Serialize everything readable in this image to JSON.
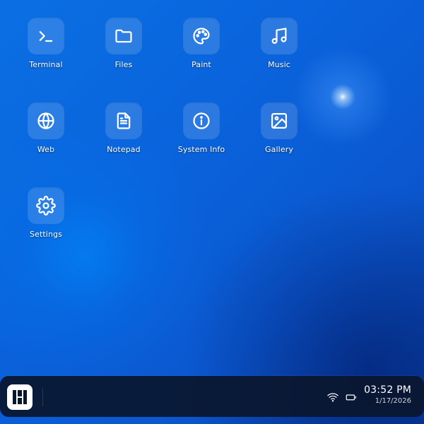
{
  "desktop": {
    "icons": [
      {
        "label": "Terminal",
        "icon": "terminal-icon"
      },
      {
        "label": "Files",
        "icon": "folder-icon"
      },
      {
        "label": "Paint",
        "icon": "palette-icon"
      },
      {
        "label": "Music",
        "icon": "music-note-icon"
      },
      {
        "label": "Web",
        "icon": "globe-icon"
      },
      {
        "label": "Notepad",
        "icon": "document-icon"
      },
      {
        "label": "System Info",
        "icon": "info-icon"
      },
      {
        "label": "Gallery",
        "icon": "image-icon"
      },
      {
        "label": "Settings",
        "icon": "gear-icon"
      }
    ]
  },
  "taskbar": {
    "start_icon": "start-logo-icon",
    "tray": [
      {
        "icon": "wifi-icon"
      },
      {
        "icon": "battery-icon"
      }
    ],
    "clock": {
      "time": "03:52 PM",
      "date": "1/17/2026"
    }
  },
  "colors": {
    "wallpaper_primary": "#0b63dc",
    "wallpaper_dark": "#0a3fa6",
    "taskbar_bg": "#0a162d",
    "text": "#ffffff"
  }
}
